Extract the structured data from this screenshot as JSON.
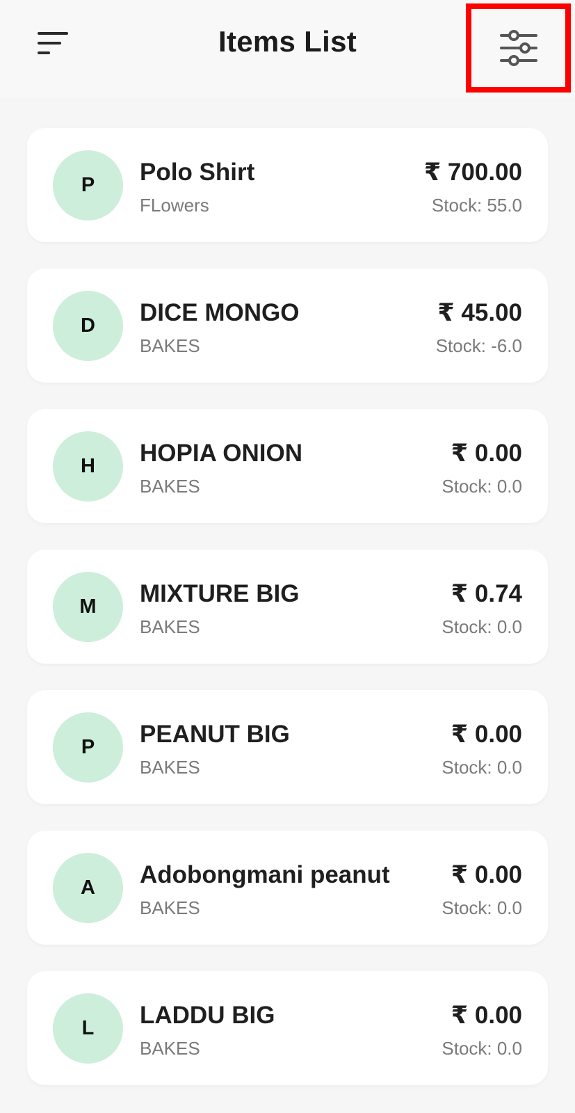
{
  "app_bar": {
    "title": "Items List",
    "menu_icon": "sort-lines-icon",
    "filter_icon": "sliders-icon",
    "highlight_color": "#ff0000"
  },
  "theme": {
    "avatar_bg": "#cdeedb",
    "background": "#f6f6f6",
    "card_bg": "#ffffff"
  },
  "items": [
    {
      "initial": "P",
      "name": "Polo Shirt",
      "category": "FLowers",
      "price": "₹ 700.00",
      "stock": "Stock: 55.0"
    },
    {
      "initial": "D",
      "name": "DICE MONGO",
      "category": "BAKES",
      "price": "₹ 45.00",
      "stock": "Stock: -6.0"
    },
    {
      "initial": "H",
      "name": "HOPIA ONION",
      "category": "BAKES",
      "price": "₹ 0.00",
      "stock": "Stock: 0.0"
    },
    {
      "initial": "M",
      "name": "MIXTURE BIG",
      "category": "BAKES",
      "price": "₹ 0.74",
      "stock": "Stock: 0.0"
    },
    {
      "initial": "P",
      "name": "PEANUT BIG",
      "category": "BAKES",
      "price": "₹ 0.00",
      "stock": "Stock: 0.0"
    },
    {
      "initial": "A",
      "name": "Adobongmani peanut",
      "category": "BAKES",
      "price": "₹ 0.00",
      "stock": "Stock: 0.0"
    },
    {
      "initial": "L",
      "name": "LADDU BIG",
      "category": "BAKES",
      "price": "₹ 0.00",
      "stock": "Stock: 0.0"
    }
  ]
}
